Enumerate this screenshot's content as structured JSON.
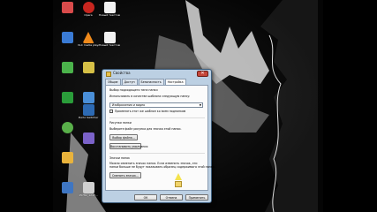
{
  "desktop": {
    "icons": [
      {
        "label": "",
        "color": "#d94b4b"
      },
      {
        "label": "Opera",
        "color": "#c8261f"
      },
      {
        "label": "Новый текстовый",
        "color": "#f2f2f2"
      },
      {
        "label": "",
        "color": "#3a7bd5"
      },
      {
        "label": "VLC media player",
        "color": "#f08a1b"
      },
      {
        "label": "Новый текстовый",
        "color": "#f2f2f2"
      },
      {
        "label": "",
        "color": "#4bb34b"
      },
      {
        "label": "",
        "color": "#d6c046"
      },
      {
        "label": "",
        "color": "#2a9d3a"
      },
      {
        "label": "",
        "color": "#4a8fd8"
      },
      {
        "label": "Punto Switcher",
        "color": "#2d6ab3"
      },
      {
        "label": "",
        "color": "#59b04a"
      },
      {
        "label": "",
        "color": "#7b62c9"
      },
      {
        "label": "",
        "color": "#e9b33c"
      },
      {
        "label": "",
        "color": "#3f76c2"
      },
      {
        "label": "15782_1247...",
        "color": "#d0d0d0"
      }
    ]
  },
  "dialog": {
    "title": "Свойства",
    "tabs": [
      "Общие",
      "Доступ",
      "Безопасность",
      "Настройка"
    ],
    "section1_heading": "Выбор подходящего типа папки",
    "section1_text": "Использовать в качестве шаблона следующую папку:",
    "select_value": "Изображения и видео",
    "checkbox_label": "Применять этот же шаблон ко всем подпапкам",
    "section2_heading": "Рисунки папки",
    "section2_text": "Выберите файл рисунка для значка этой папки.",
    "choose_file_btn": "Выбор файла...",
    "restore_default_btn": "Восстановить умолчания",
    "section3_heading": "Значки папок",
    "section3_text_1": "Можно изменить значок папки. Если изменить значок, эти",
    "section3_text_2": "папки больше не будут показывать образец содержимого этой папки.",
    "change_icon_btn": "Сменить значок...",
    "ok_btn": "ОК",
    "cancel_btn": "Отмена",
    "apply_btn": "Применить"
  },
  "colors": {
    "cursor": "#f4e34d",
    "dialog_frame": "#bcd0e3"
  }
}
